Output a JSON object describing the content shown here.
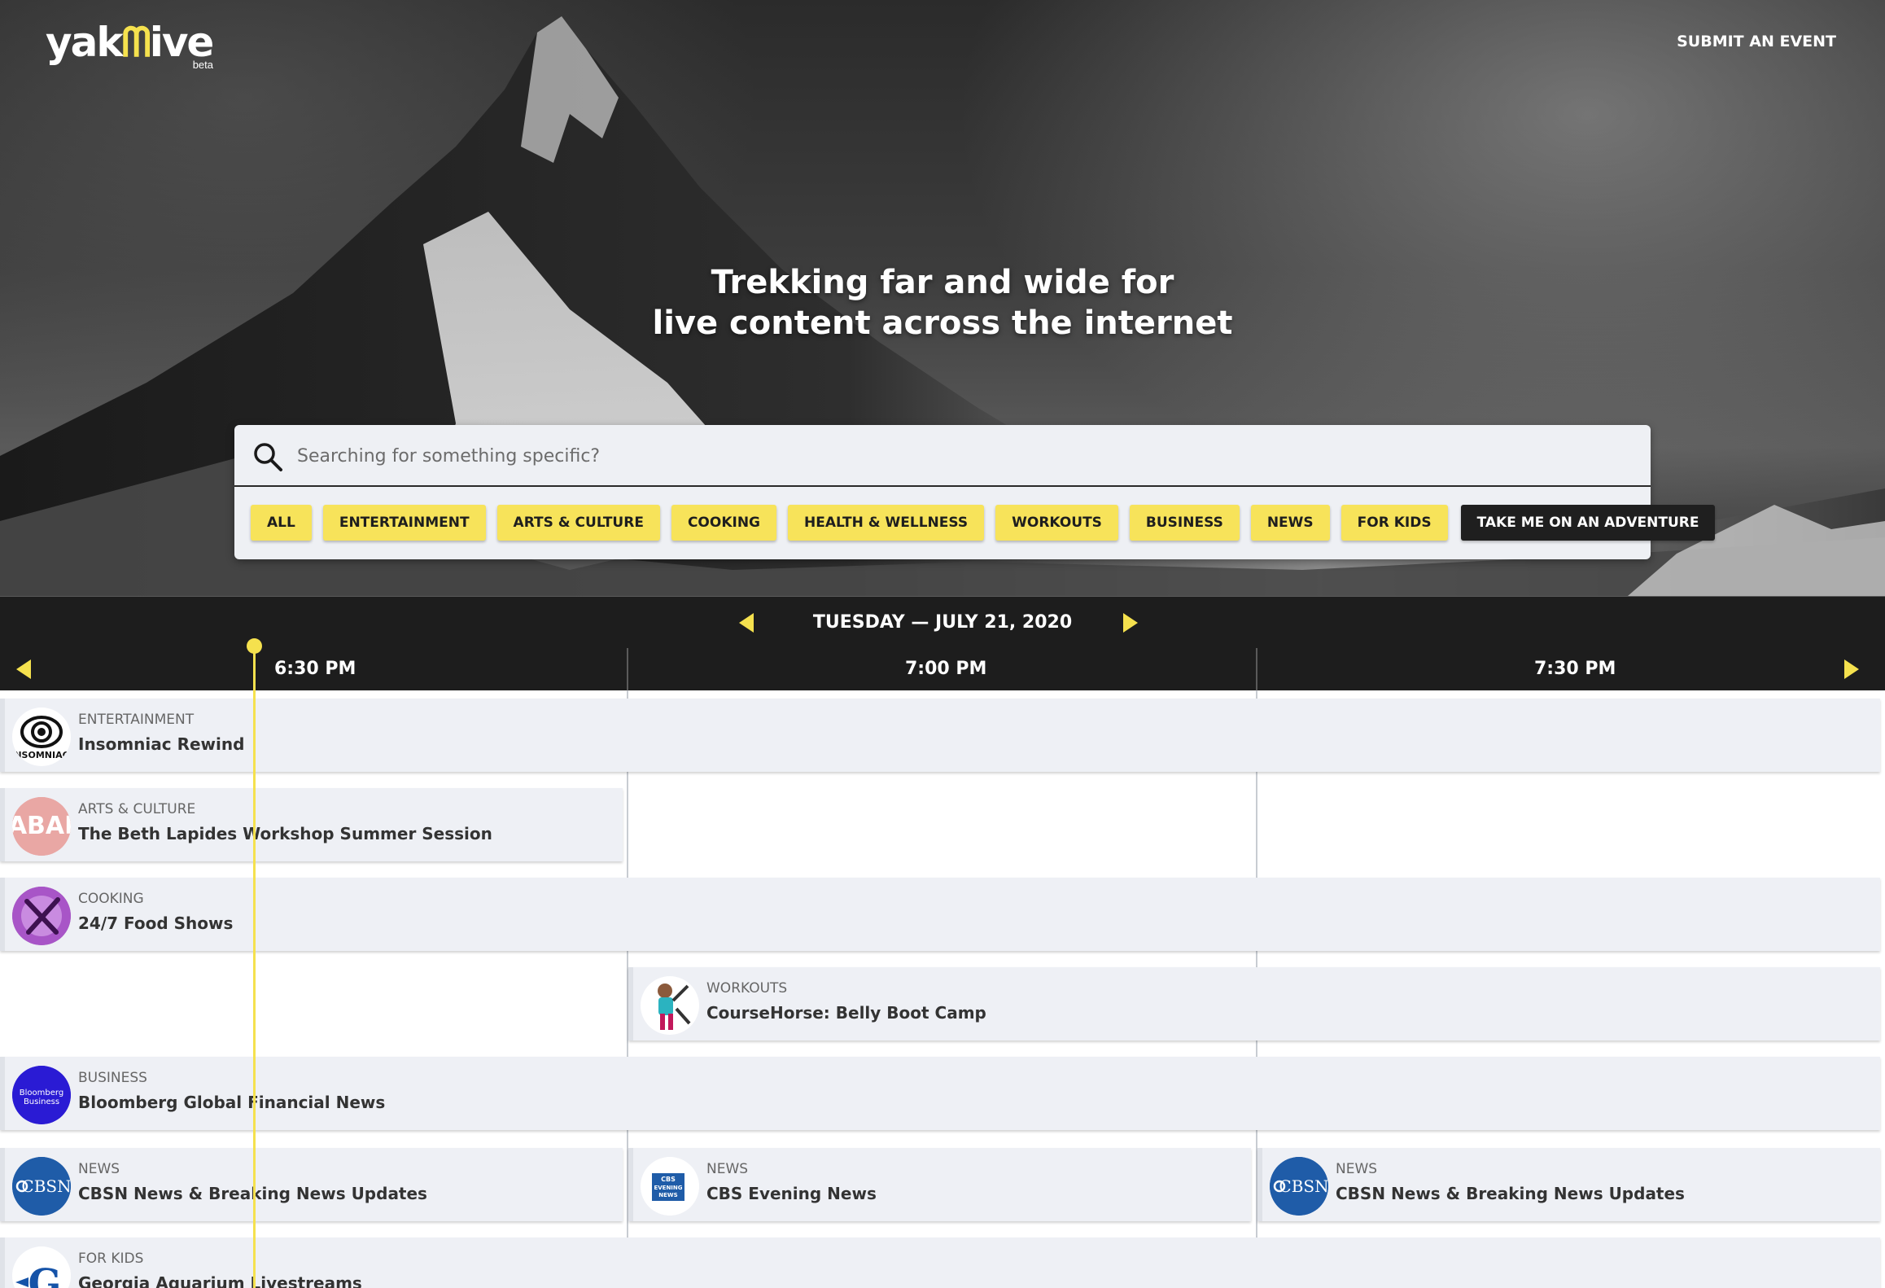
{
  "header": {
    "logo_text_left": "yak",
    "logo_text_right": "ive",
    "logo_beta": "beta",
    "submit_link": "SUBMIT AN EVENT"
  },
  "hero": {
    "headline_line1": "Trekking far and wide for",
    "headline_line2": "live content across the internet"
  },
  "search": {
    "placeholder": "Searching for something specific?",
    "value": ""
  },
  "categories": [
    "ALL",
    "ENTERTAINMENT",
    "ARTS & CULTURE",
    "COOKING",
    "HEALTH & WELLNESS",
    "WORKOUTS",
    "BUSINESS",
    "NEWS",
    "FOR KIDS",
    "TAKE ME ON AN ADVENTURE"
  ],
  "schedule": {
    "date_label": "TUESDAY — JULY 21, 2020",
    "time_slots": [
      "6:30 PM",
      "7:00 PM",
      "7:30 PM"
    ],
    "events": [
      {
        "category": "ENTERTAINMENT",
        "title": "Insomniac Rewind",
        "logo": "insomniac-logo",
        "logo_text": "NSOMNIAC"
      },
      {
        "category": "ARTS & CULTURE",
        "title": "The Beth Lapides Workshop Summer Session",
        "logo": "cabaret-logo",
        "logo_text": "CABAR"
      },
      {
        "category": "COOKING",
        "title": "24/7 Food Shows",
        "logo": "food-shows-logo"
      },
      {
        "category": "WORKOUTS",
        "title": "CourseHorse: Belly Boot Camp",
        "logo": "coursehorse-logo"
      },
      {
        "category": "BUSINESS",
        "title": "Bloomberg Global Financial News",
        "logo": "bloomberg-logo",
        "logo_text": "Bloomberg Business"
      },
      {
        "category": "NEWS",
        "title": "CBSN News & Breaking News Updates",
        "logo": "cbsn-logo",
        "logo_text": "CBSN"
      },
      {
        "category": "NEWS",
        "title": "CBS Evening News",
        "logo": "cbs-evening-news-logo",
        "logo_text": "CBS EVENING NEWS"
      },
      {
        "category": "NEWS",
        "title": "CBSN News & Breaking News Updates",
        "logo": "cbsn-logo",
        "logo_text": "CBSN"
      },
      {
        "category": "FOR KIDS",
        "title": "Georgia Aquarium Livestreams",
        "logo": "georgia-aquarium-logo"
      }
    ]
  },
  "colors": {
    "accent_yellow": "#f5e14e",
    "chip_yellow": "#f7e35a",
    "dark_bar": "#1d1d1d",
    "event_bg": "#eef0f5"
  }
}
